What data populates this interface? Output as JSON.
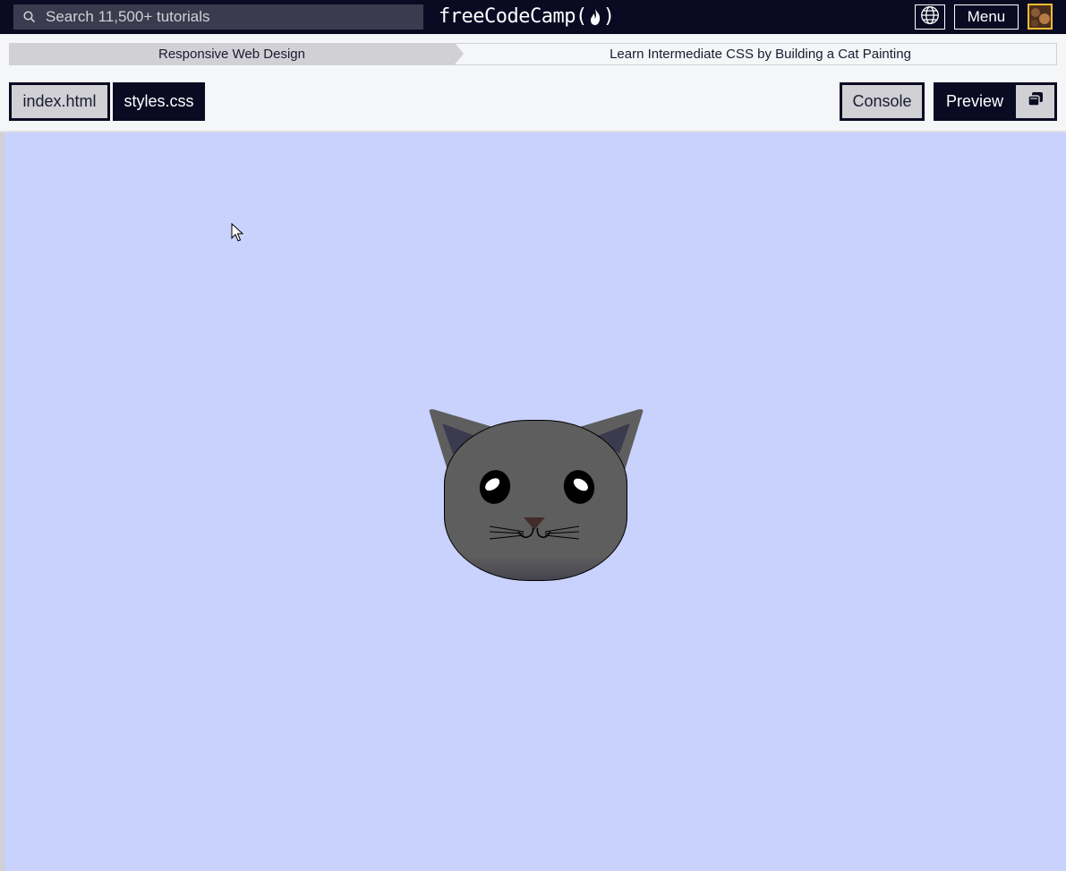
{
  "topnav": {
    "search_placeholder": "Search 11,500+ tutorials",
    "logo_text_left": "freeCodeCamp(",
    "logo_text_right": ")",
    "menu_label": "Menu",
    "icons": {
      "search": "search-icon",
      "globe": "globe-icon",
      "flame": "flame-icon"
    }
  },
  "breadcrumb": {
    "items": [
      "Responsive Web Design",
      "Learn Intermediate CSS by Building a Cat Painting"
    ]
  },
  "tabs": {
    "index_label": "index.html",
    "styles_label": "styles.css",
    "console_label": "Console",
    "preview_label": "Preview",
    "popout_icon": "popout-window-icon"
  },
  "preview": {
    "background_color": "#c9d2fc",
    "cat_colors": {
      "head": "#5e5e5e",
      "ear": "#5e5e5e",
      "inner_ear": "#3b3b4f",
      "nose": "#442c2c",
      "eye": "#000000",
      "eye_highlight": "#ffffff"
    }
  },
  "colors": {
    "primary_dark": "#0a0a23",
    "secondary": "#3b3b4f",
    "accent": "#f1be32",
    "light_gray": "#d0d0d5"
  }
}
